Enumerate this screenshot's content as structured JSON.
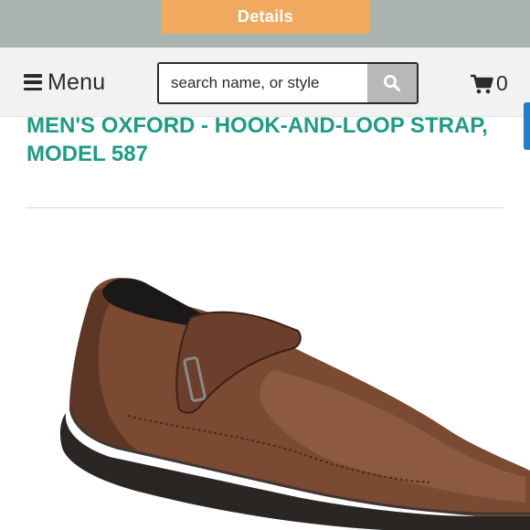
{
  "top": {
    "details_label": "Details"
  },
  "header": {
    "menu_label": "Menu",
    "search": {
      "placeholder": "search name, or style",
      "value": ""
    },
    "cart_count": "0"
  },
  "product": {
    "title": "MEN'S OXFORD - HOOK-AND-LOOP STRAP, MODEL 587",
    "image_alt": "Brown leather oxford shoe with hook-and-loop strap"
  },
  "colors": {
    "accent_orange": "#f0a95e",
    "title_teal": "#1f9a85",
    "top_band": "#a9b4b0",
    "header_bg": "#f2f2f2",
    "search_button": "#b8b8b8",
    "edge_tab_blue": "#1f7fcf"
  },
  "icons": {
    "menu": "hamburger-icon",
    "search": "search-icon",
    "cart": "cart-icon"
  }
}
